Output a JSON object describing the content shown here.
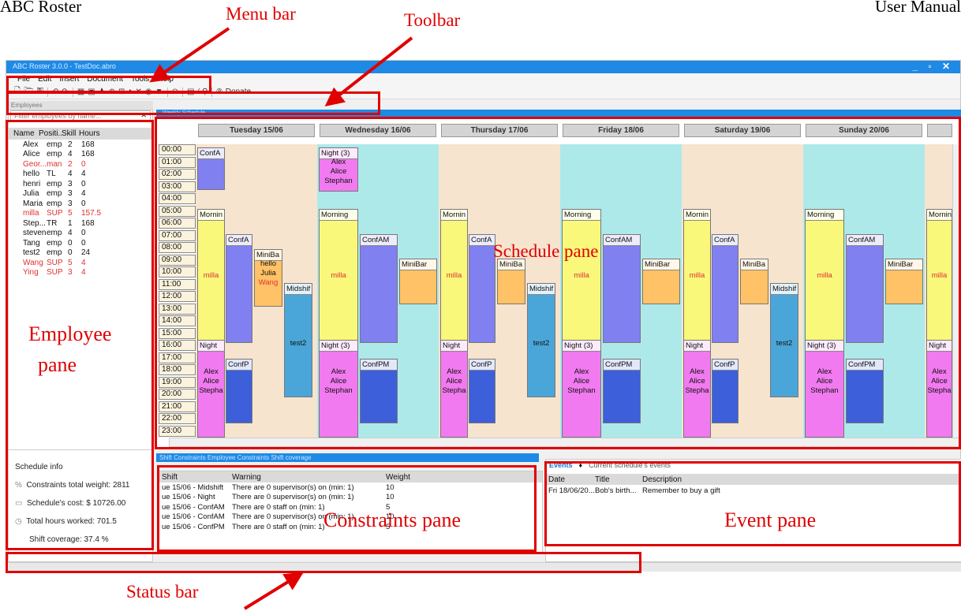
{
  "doc": {
    "left_header": "ABC Roster",
    "right_header": "User Manual"
  },
  "annotations": {
    "menu_bar": "Menu bar",
    "toolbar": "Toolbar",
    "schedule_pane": "Schedule pane",
    "employee_pane_line1": "Employee",
    "employee_pane_line2": "pane",
    "constraints_pane": "Constraints pane",
    "event_pane": "Event pane",
    "status_bar": "Status bar",
    "color": "#e00000"
  },
  "app": {
    "title": "ABC Roster 3.0.0 - TestDoc.abro",
    "window_controls": "_ ▫ ✕",
    "accent": "#1e8ae6",
    "menu": [
      "File",
      "Edit",
      "Insert",
      "Document",
      "Tools",
      "Help"
    ],
    "toolbar_icons": [
      "new-file-icon",
      "open-icon",
      "save-icon",
      "undo-icon",
      "redo-icon",
      "calendar-icon",
      "calendar-edit-icon",
      "users-icon",
      "add-icon",
      "grid-icon",
      "bell-icon",
      "shuffle-icon",
      "eye-icon",
      "filter-icon",
      "circle-icon",
      "report-icon",
      "wand-icon",
      "zoom-icon",
      "paypal-icon"
    ],
    "donate_label": "Donate"
  },
  "employees": {
    "pane_title": "Employees",
    "filter_placeholder": "Filter employees by name...",
    "columns": [
      "Name",
      "Positi...",
      "Skill",
      "Hours"
    ],
    "rows": [
      {
        "name": "Alex",
        "pos": "emp",
        "skill": "2",
        "hours": "168",
        "red": false
      },
      {
        "name": "Alice",
        "pos": "emp",
        "skill": "4",
        "hours": "168",
        "red": false
      },
      {
        "name": "Geor...",
        "pos": "man",
        "skill": "2",
        "hours": "0",
        "red": true
      },
      {
        "name": "hello",
        "pos": "TL",
        "skill": "4",
        "hours": "4",
        "red": false
      },
      {
        "name": "henri",
        "pos": "emp",
        "skill": "3",
        "hours": "0",
        "red": false
      },
      {
        "name": "Julia",
        "pos": "emp",
        "skill": "3",
        "hours": "4",
        "red": false
      },
      {
        "name": "Maria",
        "pos": "emp",
        "skill": "3",
        "hours": "0",
        "red": false
      },
      {
        "name": "milla",
        "pos": "SUP",
        "skill": "5",
        "hours": "157.5",
        "red": true
      },
      {
        "name": "Step...",
        "pos": "TR",
        "skill": "1",
        "hours": "168",
        "red": false
      },
      {
        "name": "steven",
        "pos": "emp",
        "skill": "4",
        "hours": "0",
        "red": false
      },
      {
        "name": "Tang",
        "pos": "emp",
        "skill": "0",
        "hours": "0",
        "red": false
      },
      {
        "name": "test2",
        "pos": "emp",
        "skill": "0",
        "hours": "24",
        "red": false
      },
      {
        "name": "Wang",
        "pos": "SUP",
        "skill": "5",
        "hours": "4",
        "red": true
      },
      {
        "name": "Ying",
        "pos": "SUP",
        "skill": "3",
        "hours": "4",
        "red": true
      }
    ]
  },
  "schedule_info": {
    "title": "Schedule info",
    "constraints": "Constraints total weight: 2811",
    "cost": "Schedule's cost: $ 10726.00",
    "hours": "Total hours worked: 701.5",
    "coverage": "Shift coverage: 37.4 %"
  },
  "schedule": {
    "tab_label": "Weekly Schedule",
    "days": [
      "Tuesday 15/06",
      "Wednesday 16/06",
      "Thursday 17/06",
      "Friday 18/06",
      "Saturday 19/06",
      "Sunday 20/06"
    ],
    "day_colors": [
      "#f7e4cf",
      "#aee9ea",
      "#f7e4cf",
      "#aee9ea",
      "#f7e4cf",
      "#aee9ea",
      "#f7e4cf"
    ],
    "times": [
      "00:00",
      "01:00",
      "02:00",
      "03:00",
      "04:00",
      "05:00",
      "06:00",
      "07:00",
      "08:00",
      "09:00",
      "10:00",
      "11:00",
      "12:00",
      "13:00",
      "14:00",
      "15:00",
      "16:00",
      "17:00",
      "18:00",
      "19:00",
      "20:00",
      "21:00",
      "22:00",
      "23:00"
    ],
    "colors": {
      "morning": "#f9f87b",
      "confa": "#8080f0",
      "minibar": "#ffc266",
      "midshift": "#4aa6d8",
      "night": "#f27af0",
      "confp": "#3d5fd9"
    },
    "shifts": {
      "confa": "ConfA",
      "confam": "ConfAM",
      "night": "Night",
      "night3": "Night (3)",
      "morning": "Mornin",
      "morning_full": "Morning",
      "minibar_short": "MiniBa",
      "minibar": "MiniBar",
      "midshift": "Midshif",
      "confp": "ConfP",
      "confpm": "ConfPM",
      "milla": "milla",
      "test2": "test2",
      "alex": "Alex",
      "alice": "Alice",
      "stephan": "Stephan",
      "stepha": "Stepha",
      "hello": "hello",
      "julia": "Julia",
      "wang": "Wang"
    }
  },
  "constraints": {
    "tabs": "Shift Constraints   Employee Constraints   Shift coverage",
    "columns": [
      "Shift",
      "Warning",
      "Weight"
    ],
    "rows": [
      {
        "shift": "ue 15/06 - Midshift",
        "warning": "There are 0 supervisor(s) on (min: 1)",
        "weight": "10"
      },
      {
        "shift": "ue 15/06 - Night",
        "warning": "There are 0 supervisor(s) on (min: 1)",
        "weight": "10"
      },
      {
        "shift": "ue 15/06 - ConfAM",
        "warning": "There are 0 staff on (min: 1)",
        "weight": "5"
      },
      {
        "shift": "ue 15/06 - ConfAM",
        "warning": "There are 0 supervisor(s) on (min: 1)",
        "weight": "10"
      },
      {
        "shift": "ue 15/06 - ConfPM",
        "warning": "There are 0 staff on (min: 1)",
        "weight": "5"
      }
    ]
  },
  "events": {
    "tab1": "Events",
    "tab2": "Current schedule's events",
    "columns": [
      "Date",
      "Title",
      "Description"
    ],
    "rows": [
      {
        "date": "Fri 18/06/20...",
        "title": "Bob's birth...",
        "description": "Remember to buy a gift"
      }
    ]
  }
}
